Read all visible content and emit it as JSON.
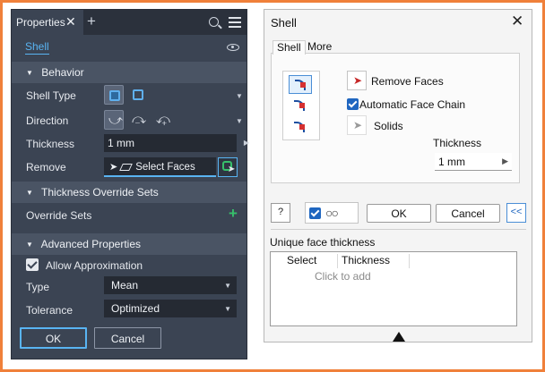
{
  "properties_panel": {
    "tab_title": "Properties",
    "tab_close_glyph": "✕",
    "add_tab_glyph": "+",
    "feature_name": "Shell",
    "sections": {
      "behavior": "Behavior",
      "thickness_override": "Thickness Override Sets",
      "advanced": "Advanced Properties"
    },
    "labels": {
      "shell_type": "Shell Type",
      "direction": "Direction",
      "thickness": "Thickness",
      "remove": "Remove",
      "override_sets": "Override Sets",
      "allow_approximation": "Allow Approximation",
      "type": "Type",
      "tolerance": "Tolerance"
    },
    "thickness_value": "1 mm",
    "remove_placeholder": "Select Faces",
    "allow_approximation_checked": true,
    "type_value": "Mean",
    "tolerance_value": "Optimized",
    "ok_label": "OK",
    "cancel_label": "Cancel",
    "icons": [
      "search-icon",
      "menu-icon",
      "eye-icon",
      "add-icon"
    ],
    "accent_color": "#59b4f2",
    "add_color": "#37c06b"
  },
  "shell_dialog": {
    "title": "Shell",
    "close_glyph": "✕",
    "tabs": [
      "Shell",
      "More"
    ],
    "remove_faces_label": "Remove Faces",
    "automatic_face_chain_label": "Automatic Face Chain",
    "automatic_face_chain_checked": true,
    "solids_label": "Solids",
    "thickness_label": "Thickness",
    "thickness_value": "1 mm",
    "help_glyph": "?",
    "preview_checked": true,
    "ok_label": "OK",
    "cancel_label": "Cancel",
    "collapse_label": "<<",
    "unique_face_thickness_label": "Unique face thickness",
    "table_headers": [
      "Select",
      "Thickness"
    ],
    "click_to_add": "Click to add"
  }
}
